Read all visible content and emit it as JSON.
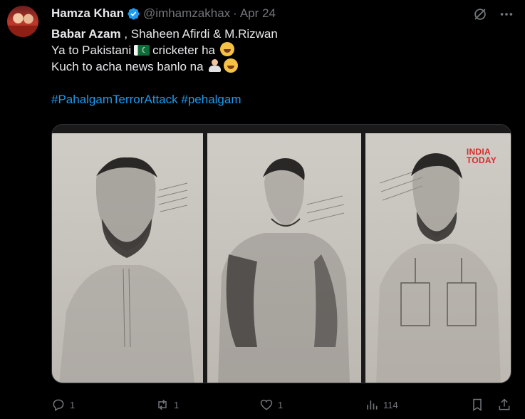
{
  "tweet": {
    "author_name": "Hamza Khan",
    "handle": "@imhamzakhax",
    "separator": "·",
    "date": "Apr 24",
    "line1_bold": "Babar Azam",
    "line1_rest": " , Shaheen Afirdi & M.Rizwan",
    "line2_a": " Ya to Pakistani",
    "line2_b": "cricketer ha",
    "line3": "Kuch to acha news banlo na",
    "hashtag1": "#PahalgamTerrorAttack",
    "hashtag2": "#pehalgam"
  },
  "media": {
    "watermark_line1": "INDIA",
    "watermark_line2": "TODAY"
  },
  "actions": {
    "replies": "1",
    "reposts": "1",
    "likes": "1",
    "views": "114"
  },
  "icons": {
    "verified": "verified-badge-icon",
    "grok": "grok-icon",
    "more": "more-icon",
    "reply": "reply-icon",
    "repost": "repost-icon",
    "like": "heart-icon",
    "views": "views-icon",
    "bookmark": "bookmark-icon",
    "share": "share-icon"
  },
  "colors": {
    "background": "#000000",
    "text": "#e7e9ea",
    "secondary": "#71767b",
    "link": "#1d9bf0",
    "verified": "#1d9bf0"
  }
}
